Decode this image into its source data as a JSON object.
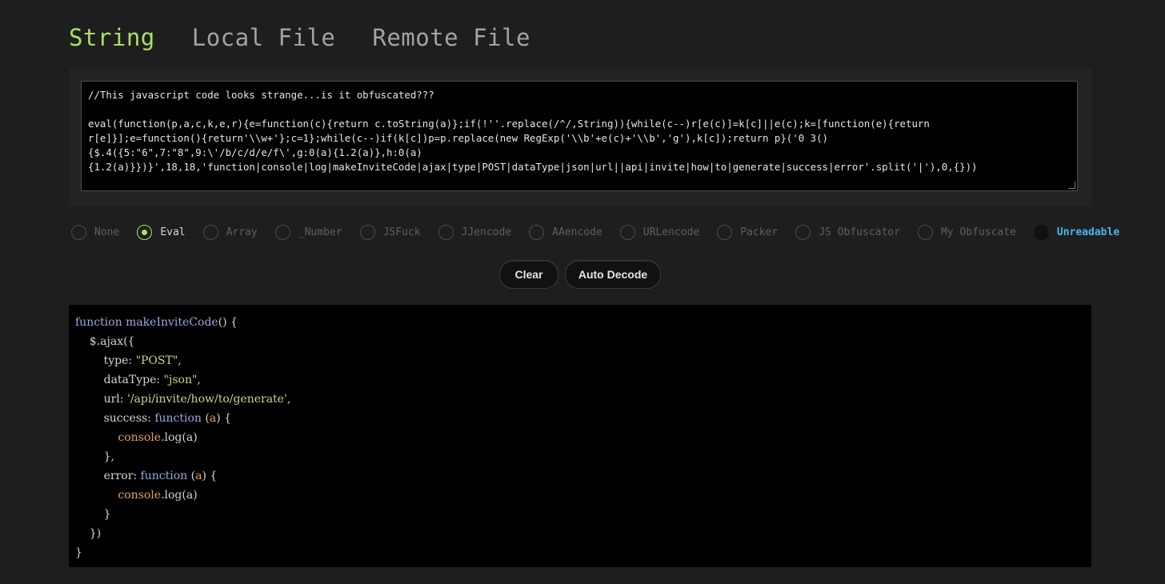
{
  "tabs": [
    {
      "label": "String",
      "active": true
    },
    {
      "label": "Local File",
      "active": false
    },
    {
      "label": "Remote File",
      "active": false
    }
  ],
  "input": {
    "text": "//This javascript code looks strange...is it obfuscated???\n\neval(function(p,a,c,k,e,r){e=function(c){return c.toString(a)};if(!''.replace(/^/,String)){while(c--)r[e(c)]=k[c]||e(c);k=[function(e){return\nr[e]}];e=function(){return'\\\\w+'};c=1};while(c--)if(k[c])p=p.replace(new RegExp('\\\\b'+e(c)+'\\\\b','g'),k[c]);return p}('0 3()\n{$.4({5:\"6\",7:\"8\",9:\\'/b/c/d/e/f\\',g:0(a){1.2(a)},h:0(a)\n{1.2(a)}})}',18,18,'function|console|log|makeInviteCode|ajax|type|POST|dataType|json|url||api|invite|how|to|generate|success|error'.split('|'),0,{}))"
  },
  "radios": [
    {
      "label": "None",
      "checked": false
    },
    {
      "label": "Eval",
      "checked": true
    },
    {
      "label": "Array",
      "checked": false
    },
    {
      "label": "_Number",
      "checked": false
    },
    {
      "label": "JSFuck",
      "checked": false
    },
    {
      "label": "JJencode",
      "checked": false
    },
    {
      "label": "AAencode",
      "checked": false
    },
    {
      "label": "URLencode",
      "checked": false
    },
    {
      "label": "Packer",
      "checked": false
    },
    {
      "label": "JS Obfuscator",
      "checked": false
    },
    {
      "label": "My Obfuscate",
      "checked": false
    },
    {
      "label": "Unreadable",
      "checked": false,
      "link": true
    }
  ],
  "buttons": {
    "clear": "Clear",
    "decode": "Auto Decode"
  },
  "output": {
    "l1_kw": "function",
    "l1_fn": "makeInviteCode",
    "l1_rest": "() {",
    "l2": "    $.ajax({",
    "l3_key": "        type: ",
    "l3_val": "\"POST\"",
    "l3_end": ",",
    "l4_key": "        dataType: ",
    "l4_val": "\"json\"",
    "l4_end": ",",
    "l5_key": "        url: ",
    "l5_val": "'/api/invite/how/to/generate'",
    "l5_end": ",",
    "l6_key": "        success: ",
    "l6_kw": "function",
    "l6_a": " (",
    "l6_var": "a",
    "l6_end": ") {",
    "l7_obj": "            console",
    "l7_rest": ".log(a)",
    "l8": "        },",
    "l9_key": "        error: ",
    "l9_kw": "function",
    "l9_a": " (",
    "l9_var": "a",
    "l9_end": ") {",
    "l10_obj": "            console",
    "l10_rest": ".log(a)",
    "l11": "        }",
    "l12": "    })",
    "l13": "}"
  }
}
